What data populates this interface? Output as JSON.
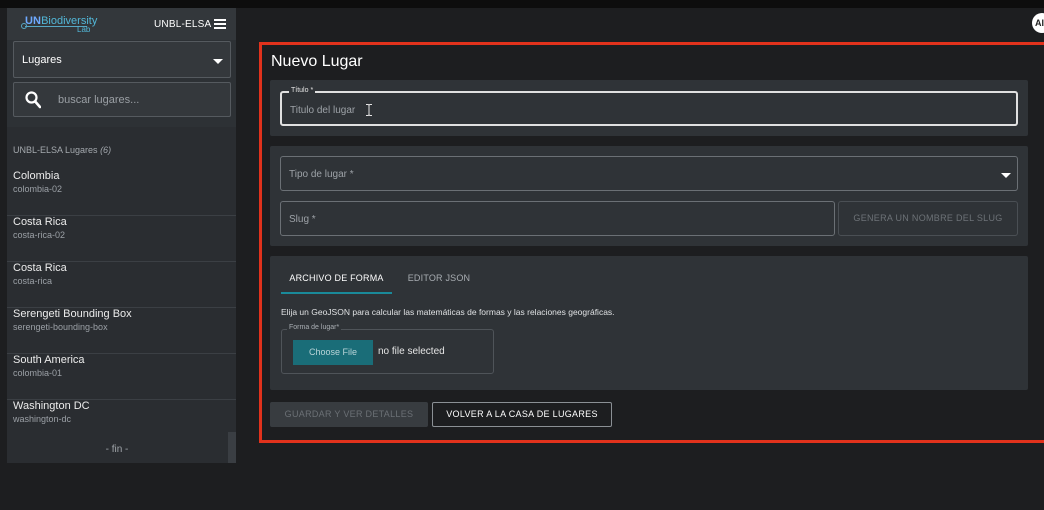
{
  "header": {
    "logo": {
      "un": "UN",
      "biodiversity": "Biodiversity",
      "lab": "Lab"
    },
    "workspace": "UNBL-ELSA",
    "avatar_initials": "AI"
  },
  "sidebar": {
    "dropdown_label": "Lugares",
    "search_placeholder": "buscar lugares...",
    "count_label": "UNBL-ELSA Lugares",
    "count_value": "(6)",
    "items": [
      {
        "name": "Colombia",
        "slug": "colombia-02"
      },
      {
        "name": "Costa Rica",
        "slug": "costa-rica-02"
      },
      {
        "name": "Costa Rica",
        "slug": "costa-rica"
      },
      {
        "name": "Serengeti Bounding Box",
        "slug": "serengeti-bounding-box"
      },
      {
        "name": "South America",
        "slug": "colombia-01"
      },
      {
        "name": "Washington DC",
        "slug": "washington-dc"
      }
    ],
    "end_label": "- fin -"
  },
  "form": {
    "title": "Nuevo Lugar",
    "title_field": {
      "legend": "Título *",
      "placeholder": "Titulo del lugar"
    },
    "type_field": {
      "placeholder": "Tipo de lugar *"
    },
    "slug_field": {
      "placeholder": "Slug *"
    },
    "generate_slug_button": "GENERA UN NOMBRE DEL SLUG",
    "tabs": [
      {
        "label": "ARCHIVO DE FORMA",
        "active": true
      },
      {
        "label": "EDITOR JSON",
        "active": false
      }
    ],
    "instructions": "Elija un GeoJSON para calcular las matemáticas de formas y las relaciones geográficas.",
    "file_field": {
      "legend": "Forma de lugar*",
      "choose_button": "Choose File",
      "status": "no file selected"
    },
    "save_button": "GUARDAR Y VER DETALLES",
    "back_button": "VOLVER A LA CASA DE LUGARES"
  },
  "colors": {
    "accent_teal": "#1a6d78",
    "highlight_frame": "#e1321c",
    "background": "#1d1e20"
  }
}
